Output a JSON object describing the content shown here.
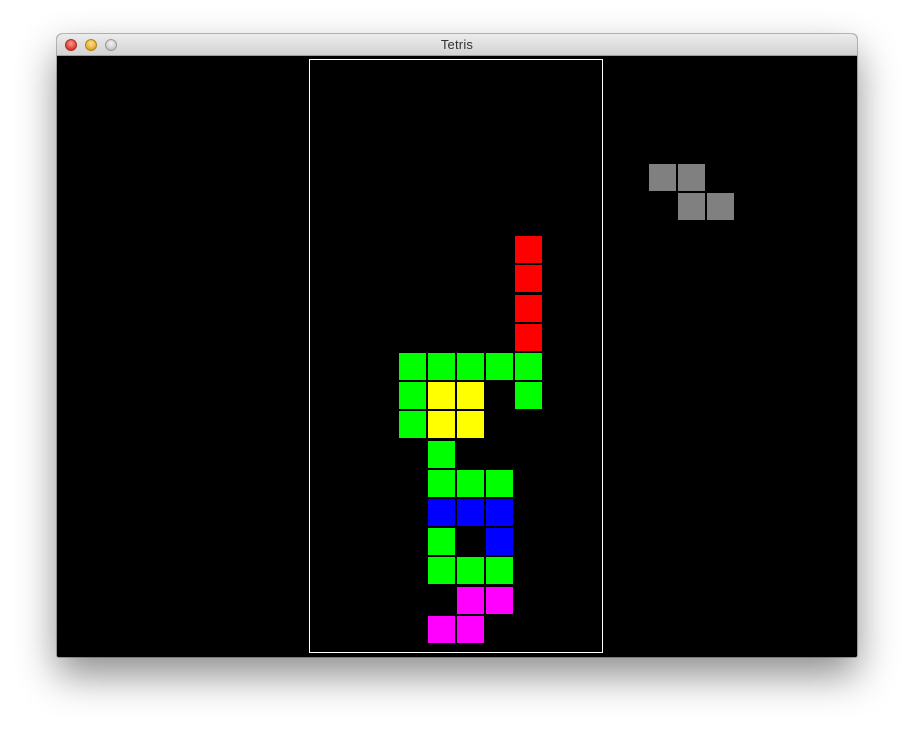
{
  "window": {
    "title": "Tetris"
  },
  "game": {
    "board_cols": 10,
    "board_rows": 20,
    "colors": {
      "red": "#ff0000",
      "green": "#00ff00",
      "yellow": "#ffff00",
      "blue": "#0000ff",
      "magenta": "#ff00ff",
      "gray": "#808080",
      "border": "#ffffff",
      "background": "#000000"
    },
    "cells": [
      {
        "col": 7,
        "row": 6,
        "color": "red"
      },
      {
        "col": 7,
        "row": 7,
        "color": "red"
      },
      {
        "col": 7,
        "row": 8,
        "color": "red"
      },
      {
        "col": 7,
        "row": 9,
        "color": "red"
      },
      {
        "col": 3,
        "row": 10,
        "color": "green"
      },
      {
        "col": 4,
        "row": 10,
        "color": "green"
      },
      {
        "col": 5,
        "row": 10,
        "color": "green"
      },
      {
        "col": 6,
        "row": 10,
        "color": "green"
      },
      {
        "col": 7,
        "row": 10,
        "color": "green"
      },
      {
        "col": 3,
        "row": 11,
        "color": "green"
      },
      {
        "col": 4,
        "row": 11,
        "color": "yellow"
      },
      {
        "col": 5,
        "row": 11,
        "color": "yellow"
      },
      {
        "col": 7,
        "row": 11,
        "color": "green"
      },
      {
        "col": 3,
        "row": 12,
        "color": "green"
      },
      {
        "col": 4,
        "row": 12,
        "color": "yellow"
      },
      {
        "col": 5,
        "row": 12,
        "color": "yellow"
      },
      {
        "col": 4,
        "row": 13,
        "color": "green"
      },
      {
        "col": 4,
        "row": 14,
        "color": "green"
      },
      {
        "col": 5,
        "row": 14,
        "color": "green"
      },
      {
        "col": 6,
        "row": 14,
        "color": "green"
      },
      {
        "col": 4,
        "row": 15,
        "color": "blue"
      },
      {
        "col": 5,
        "row": 15,
        "color": "blue"
      },
      {
        "col": 6,
        "row": 15,
        "color": "blue"
      },
      {
        "col": 4,
        "row": 16,
        "color": "green"
      },
      {
        "col": 6,
        "row": 16,
        "color": "blue"
      },
      {
        "col": 4,
        "row": 17,
        "color": "green"
      },
      {
        "col": 5,
        "row": 17,
        "color": "green"
      },
      {
        "col": 6,
        "row": 17,
        "color": "green"
      },
      {
        "col": 5,
        "row": 18,
        "color": "magenta"
      },
      {
        "col": 6,
        "row": 18,
        "color": "magenta"
      },
      {
        "col": 4,
        "row": 19,
        "color": "magenta"
      },
      {
        "col": 5,
        "row": 19,
        "color": "magenta"
      }
    ],
    "next_piece": {
      "shape": "Z",
      "color": "gray",
      "cells": [
        {
          "col": 0,
          "row": 0
        },
        {
          "col": 1,
          "row": 0
        },
        {
          "col": 1,
          "row": 1
        },
        {
          "col": 2,
          "row": 1
        }
      ]
    }
  }
}
